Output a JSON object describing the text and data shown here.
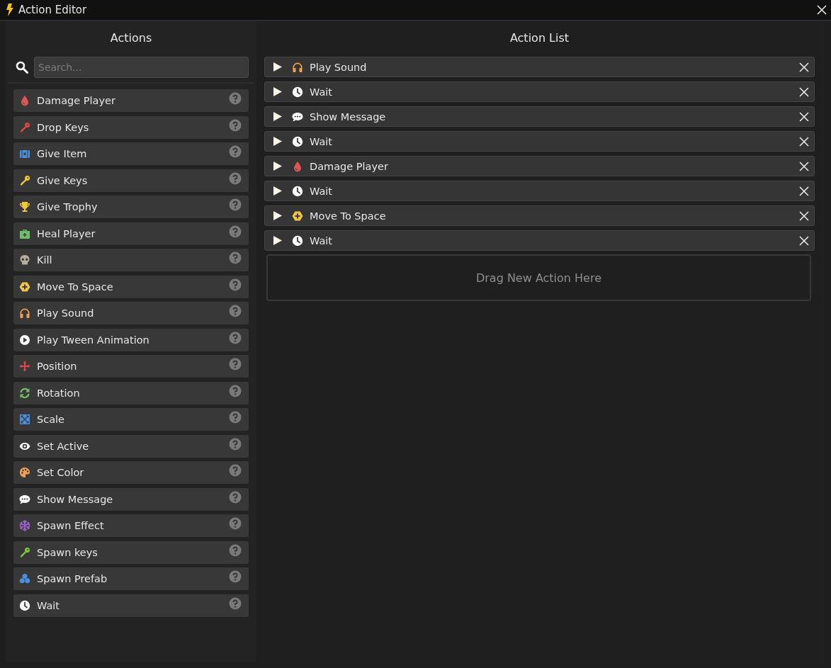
{
  "window": {
    "title": "Action Editor"
  },
  "actions_panel": {
    "title": "Actions",
    "search": {
      "placeholder": "Search..."
    },
    "items": [
      {
        "label": "Damage Player",
        "kind": "drop",
        "color": "#e05555"
      },
      {
        "label": "Drop Keys",
        "kind": "key",
        "color": "#e04848"
      },
      {
        "label": "Give Item",
        "kind": "chest",
        "color": "#4a90e2"
      },
      {
        "label": "Give Keys",
        "kind": "key",
        "color": "#f0c830"
      },
      {
        "label": "Give Trophy",
        "kind": "trophy",
        "color": "#f0c830"
      },
      {
        "label": "Heal Player",
        "kind": "medkit",
        "color": "#6fbf6a"
      },
      {
        "label": "Kill",
        "kind": "skull",
        "color": "#b8ad98"
      },
      {
        "label": "Move To Space",
        "kind": "hexplus",
        "color": "#f5c542"
      },
      {
        "label": "Play Sound",
        "kind": "headphones",
        "color": "#f0a050"
      },
      {
        "label": "Play Tween Animation",
        "kind": "play",
        "color": "#ffffff"
      },
      {
        "label": "Position",
        "kind": "move",
        "color": "#e04848"
      },
      {
        "label": "Rotation",
        "kind": "rotate",
        "color": "#6fbf6a"
      },
      {
        "label": "Scale",
        "kind": "scale",
        "color": "#4a90e2"
      },
      {
        "label": "Set Active",
        "kind": "eye",
        "color": "#ffffff"
      },
      {
        "label": "Set Color",
        "kind": "palette",
        "color": "#f0a050"
      },
      {
        "label": "Show Message",
        "kind": "chat",
        "color": "#ffffff"
      },
      {
        "label": "Spawn Effect",
        "kind": "snowflake",
        "color": "#a060d0"
      },
      {
        "label": "Spawn keys",
        "kind": "key",
        "color": "#7ac840"
      },
      {
        "label": "Spawn Prefab",
        "kind": "blocks",
        "color": "#4a90e2"
      },
      {
        "label": "Wait",
        "kind": "clock",
        "color": "#ffffff"
      }
    ]
  },
  "action_list": {
    "title": "Action List",
    "rows": [
      {
        "label": "Play Sound",
        "kind": "headphones",
        "color": "#f0a050"
      },
      {
        "label": "Wait",
        "kind": "clock",
        "color": "#ffffff"
      },
      {
        "label": "Show Message",
        "kind": "chat",
        "color": "#ffffff"
      },
      {
        "label": "Wait",
        "kind": "clock",
        "color": "#ffffff"
      },
      {
        "label": "Damage Player",
        "kind": "drop",
        "color": "#e05555"
      },
      {
        "label": "Wait",
        "kind": "clock",
        "color": "#ffffff"
      },
      {
        "label": "Move To Space",
        "kind": "hexplus",
        "color": "#f5c542"
      },
      {
        "label": "Wait",
        "kind": "clock",
        "color": "#ffffff"
      }
    ],
    "drop_zone": "Drag New Action Here"
  }
}
